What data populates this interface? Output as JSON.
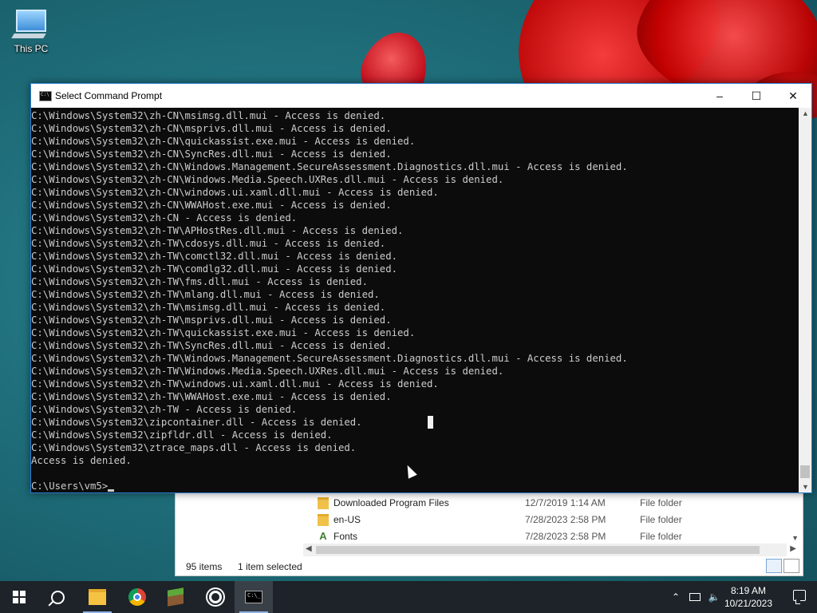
{
  "desktop": {
    "icons": [
      {
        "label": "This PC",
        "icon": "this-pc-icon"
      }
    ]
  },
  "cmd_window": {
    "title": "Select Command Prompt",
    "output_lines": [
      "C:\\Windows\\System32\\zh-CN\\msimsg.dll.mui - Access is denied.",
      "C:\\Windows\\System32\\zh-CN\\msprivs.dll.mui - Access is denied.",
      "C:\\Windows\\System32\\zh-CN\\quickassist.exe.mui - Access is denied.",
      "C:\\Windows\\System32\\zh-CN\\SyncRes.dll.mui - Access is denied.",
      "C:\\Windows\\System32\\zh-CN\\Windows.Management.SecureAssessment.Diagnostics.dll.mui - Access is denied.",
      "C:\\Windows\\System32\\zh-CN\\Windows.Media.Speech.UXRes.dll.mui - Access is denied.",
      "C:\\Windows\\System32\\zh-CN\\windows.ui.xaml.dll.mui - Access is denied.",
      "C:\\Windows\\System32\\zh-CN\\WWAHost.exe.mui - Access is denied.",
      "C:\\Windows\\System32\\zh-CN - Access is denied.",
      "C:\\Windows\\System32\\zh-TW\\APHostRes.dll.mui - Access is denied.",
      "C:\\Windows\\System32\\zh-TW\\cdosys.dll.mui - Access is denied.",
      "C:\\Windows\\System32\\zh-TW\\comctl32.dll.mui - Access is denied.",
      "C:\\Windows\\System32\\zh-TW\\comdlg32.dll.mui - Access is denied.",
      "C:\\Windows\\System32\\zh-TW\\fms.dll.mui - Access is denied.",
      "C:\\Windows\\System32\\zh-TW\\mlang.dll.mui - Access is denied.",
      "C:\\Windows\\System32\\zh-TW\\msimsg.dll.mui - Access is denied.",
      "C:\\Windows\\System32\\zh-TW\\msprivs.dll.mui - Access is denied.",
      "C:\\Windows\\System32\\zh-TW\\quickassist.exe.mui - Access is denied.",
      "C:\\Windows\\System32\\zh-TW\\SyncRes.dll.mui - Access is denied.",
      "C:\\Windows\\System32\\zh-TW\\Windows.Management.SecureAssessment.Diagnostics.dll.mui - Access is denied.",
      "C:\\Windows\\System32\\zh-TW\\Windows.Media.Speech.UXRes.dll.mui - Access is denied.",
      "C:\\Windows\\System32\\zh-TW\\windows.ui.xaml.dll.mui - Access is denied.",
      "C:\\Windows\\System32\\zh-TW\\WWAHost.exe.mui - Access is denied.",
      "C:\\Windows\\System32\\zh-TW - Access is denied.",
      "C:\\Windows\\System32\\zipcontainer.dll - Access is denied.",
      "C:\\Windows\\System32\\zipfldr.dll - Access is denied.",
      "C:\\Windows\\System32\\ztrace_maps.dll - Access is denied.",
      "Access is denied.",
      ""
    ],
    "prompt": "C:\\Users\\vm5>"
  },
  "explorer": {
    "rows": [
      {
        "name": "Downloaded Program Files",
        "date": "12/7/2019 1:14 AM",
        "type": "File folder",
        "icon": "folder-icon"
      },
      {
        "name": "en-US",
        "date": "7/28/2023 2:58 PM",
        "type": "File folder",
        "icon": "folder-icon"
      },
      {
        "name": "Fonts",
        "date": "7/28/2023 2:58 PM",
        "type": "File folder",
        "icon": "fonts-folder-icon"
      }
    ],
    "status_count": "95 items",
    "status_selected": "1 item selected"
  },
  "taskbar": {
    "apps": [
      "start-icon",
      "search-icon",
      "file-explorer-icon",
      "chrome-icon",
      "minecraft-icon",
      "settings-icon",
      "command-prompt-icon"
    ],
    "active_app": "command-prompt-icon",
    "time": "8:19 AM",
    "date": "10/21/2023"
  },
  "colors": {
    "console_bg": "#0c0c0c",
    "console_text": "#cccccc",
    "taskbar_bg": "#1d2328",
    "window_border": "#2b7bd1"
  }
}
